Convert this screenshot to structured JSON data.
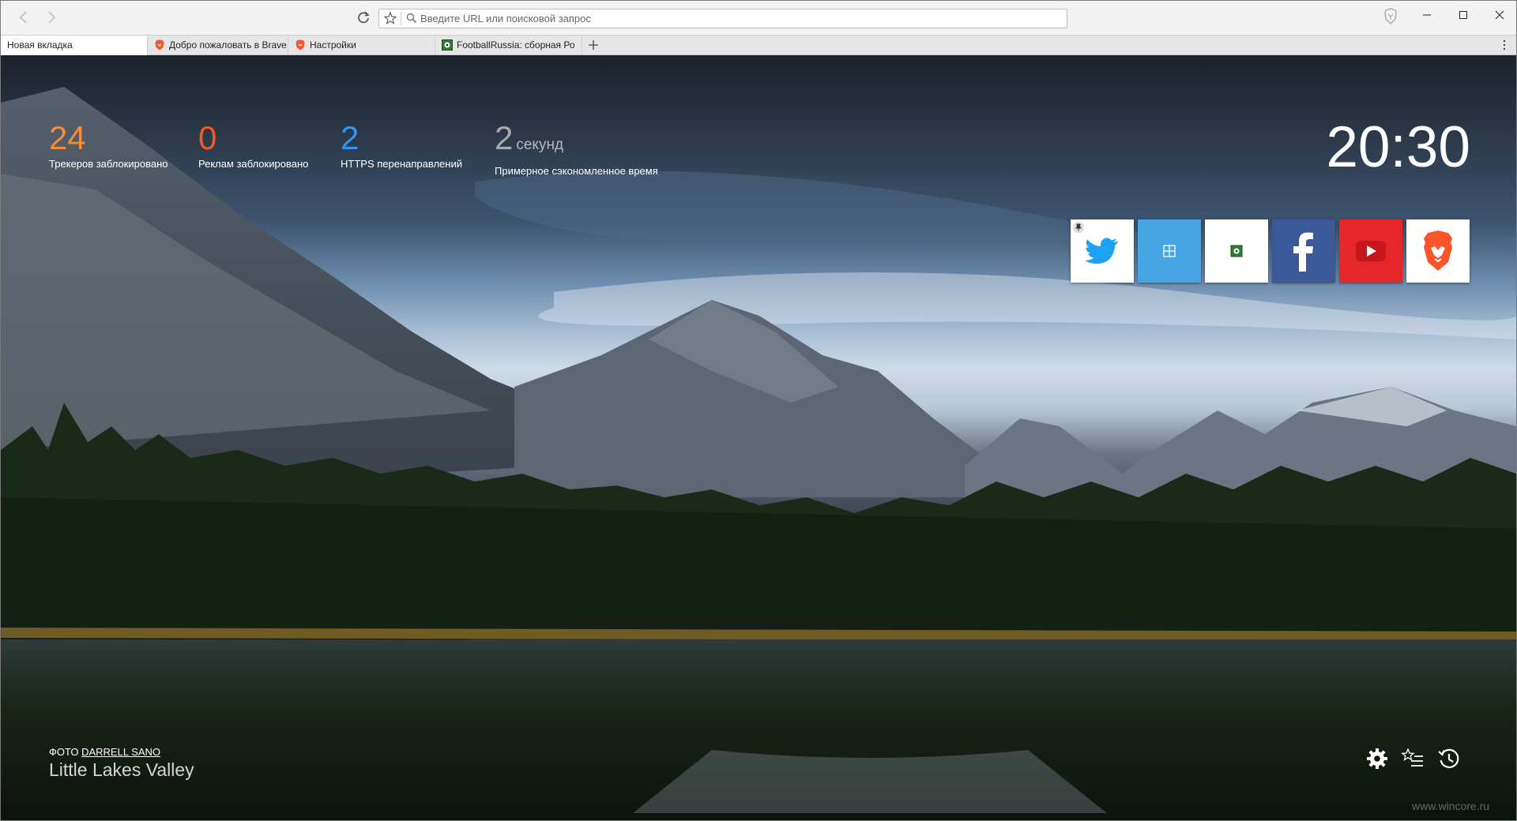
{
  "navbar": {
    "url_placeholder": "Введите URL или поисковой запрос"
  },
  "tabs": [
    {
      "label": "Новая вкладка",
      "active": true
    },
    {
      "label": "Добро пожаловать в Brave",
      "icon": "brave-lion-icon"
    },
    {
      "label": "Настройки",
      "icon": "brave-lion-icon"
    },
    {
      "label": "FootballRussia: сборная Ро",
      "icon": "football-icon"
    }
  ],
  "stats": {
    "trackers": {
      "value": "24",
      "label": "Трекеров заблокировано",
      "color": "#f28c38"
    },
    "ads": {
      "value": "0",
      "label": "Реклам заблокировано",
      "color": "#f05a2a"
    },
    "https": {
      "value": "2",
      "label": "HTTPS перенаправлений",
      "color": "#2f95f0"
    },
    "time": {
      "value": "2",
      "unit": "секунд",
      "label": "Примерное сэкономленное время",
      "color": "#a9a9a9"
    }
  },
  "clock": "20:30",
  "tiles": [
    {
      "name": "twitter",
      "icon": "twitter-bird-icon",
      "color": "#1da1f2"
    },
    {
      "name": "site-2",
      "icon": "grid-icon",
      "color": "#46a6e3"
    },
    {
      "name": "site-3",
      "icon": "football-icon",
      "color": "#ffffff"
    },
    {
      "name": "facebook",
      "icon": "facebook-f-icon",
      "color": "#3b5998"
    },
    {
      "name": "youtube",
      "icon": "youtube-play-icon",
      "color": "#e5262b"
    },
    {
      "name": "brave",
      "icon": "brave-lion-icon",
      "color": "#fb542b"
    }
  ],
  "photo": {
    "credit_prefix": "ФОТО",
    "author": "DARRELL SANO",
    "title": "Little Lakes Valley"
  },
  "watermark": "www.wincore.ru"
}
